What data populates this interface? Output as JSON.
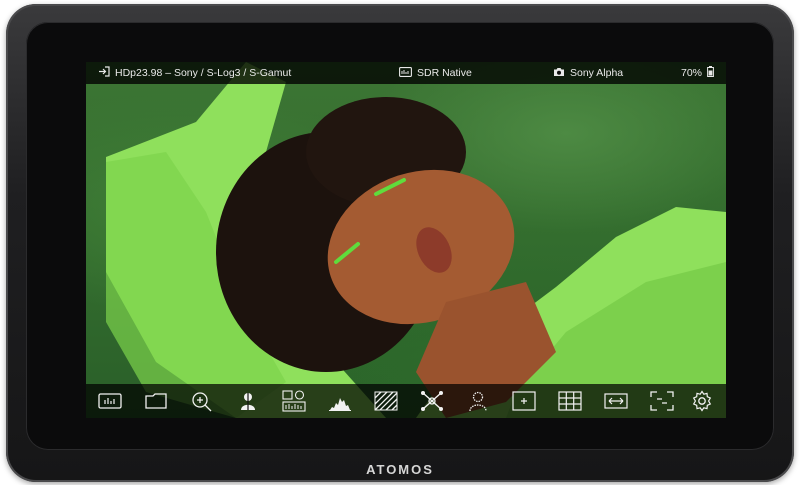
{
  "status_bar": {
    "input_label": "HDp23.98 – Sony / S-Log3 / S-Gamut",
    "monitor_mode": "SDR Native",
    "camera_name": "Sony Alpha",
    "battery": "70%"
  },
  "toolbar": {
    "tools": [
      "waveform-monitor-icon",
      "camera-folder-icon",
      "zoom-icon",
      "false-color-icon",
      "scopes-icon",
      "histogram-icon",
      "zebra-icon",
      "focus-peaking-icon",
      "skin-tone-icon",
      "frame-guides-icon",
      "grid-icon",
      "anamorphic-desqueeze-icon",
      "safe-area-icon",
      "settings-gear-icon"
    ]
  },
  "brand": {
    "name": "ATOMOS"
  },
  "colors": {
    "screen_green": "#2f6a2c",
    "jacket_green": "#8ee05a",
    "skin": "#a0562f",
    "hair": "#1c120d"
  }
}
